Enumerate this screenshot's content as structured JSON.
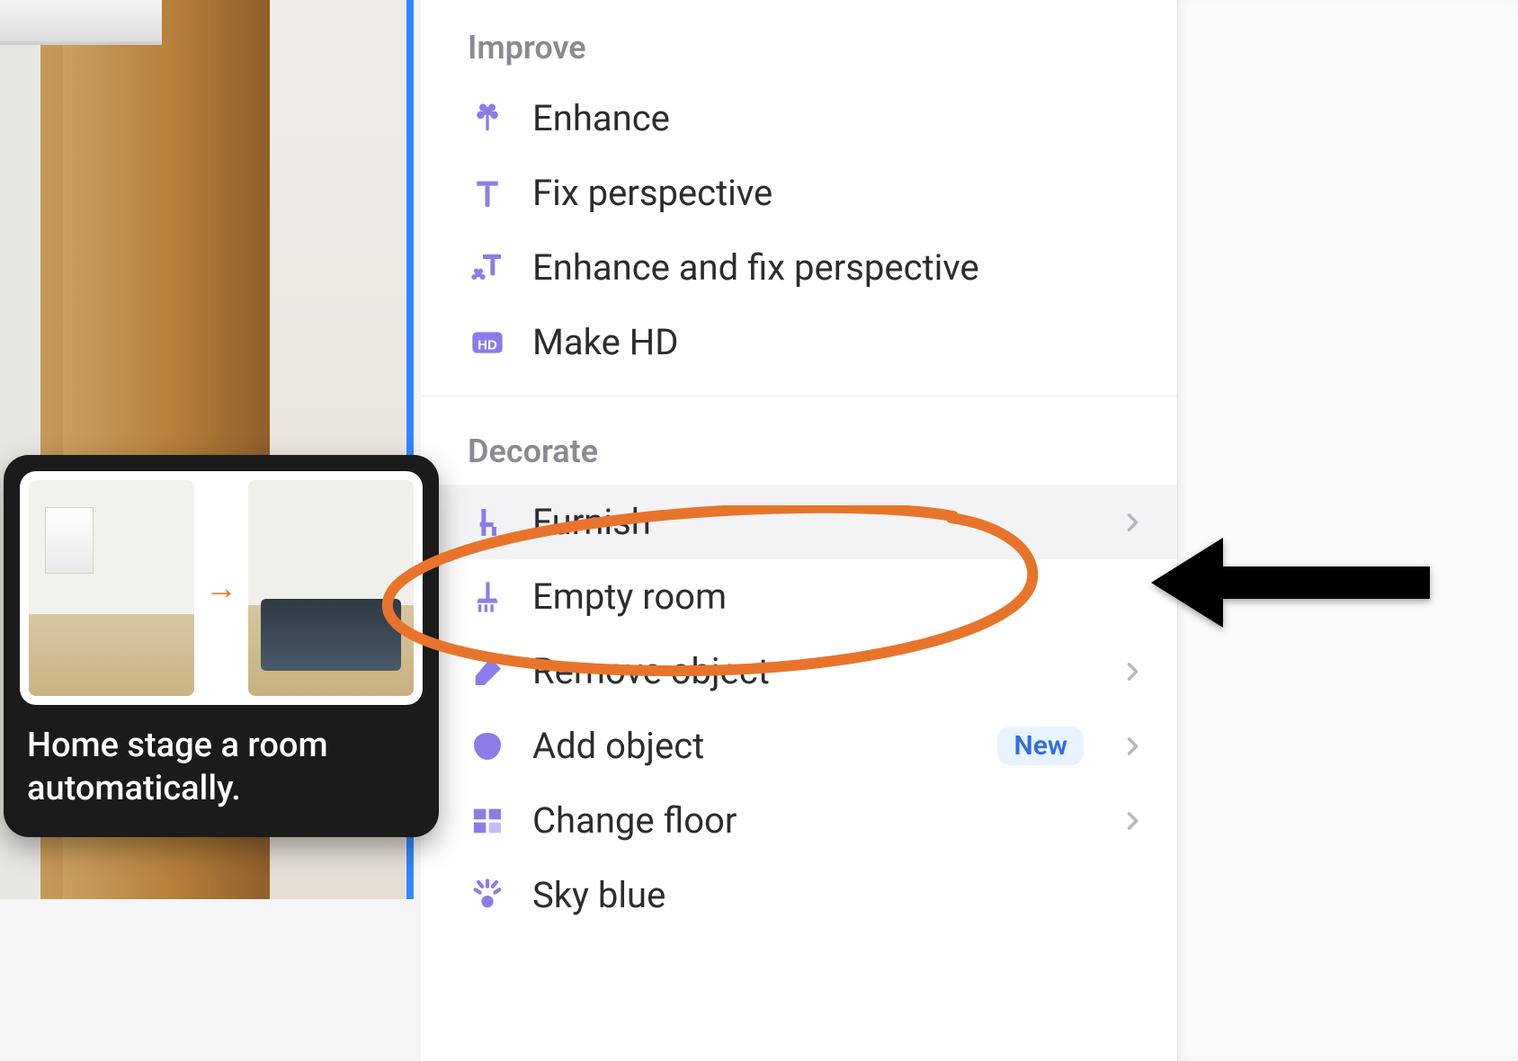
{
  "tooltip": {
    "description": "Home stage a room automatically."
  },
  "sections": {
    "improve": {
      "header": "Improve",
      "items": {
        "enhance": {
          "label": "Enhance"
        },
        "fix_perspective": {
          "label": "Fix perspective"
        },
        "enhance_fix": {
          "label": "Enhance and fix perspective"
        },
        "make_hd": {
          "label": "Make HD"
        }
      }
    },
    "decorate": {
      "header": "Decorate",
      "items": {
        "furnish": {
          "label": "Furnish"
        },
        "empty_room": {
          "label": "Empty room"
        },
        "remove_object": {
          "label": "Remove object"
        },
        "add_object": {
          "label": "Add object",
          "badge": "New"
        },
        "change_floor": {
          "label": "Change floor"
        },
        "sky_blue": {
          "label": "Sky blue"
        }
      }
    }
  }
}
